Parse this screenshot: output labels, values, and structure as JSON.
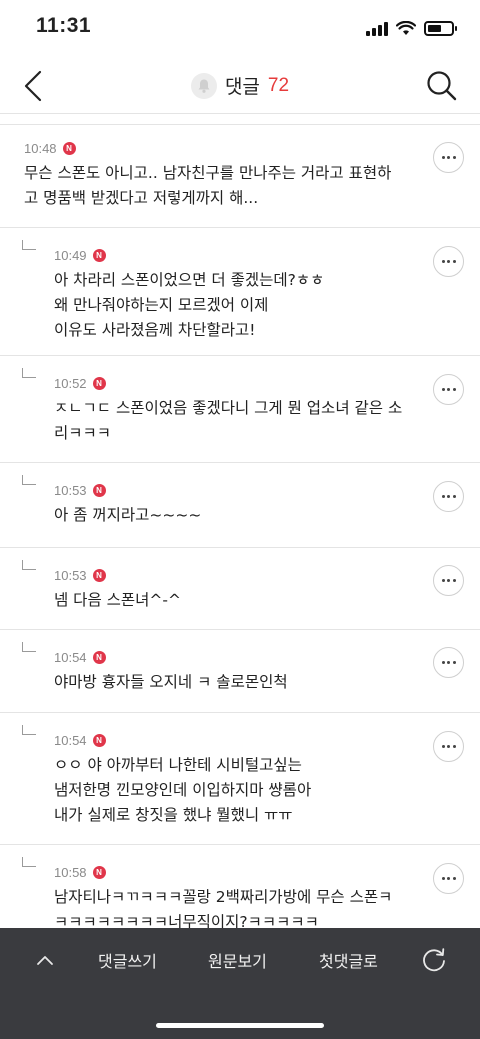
{
  "status_bar": {
    "time": "11:31"
  },
  "header": {
    "title": "댓글",
    "count": "72"
  },
  "comments": [
    {
      "time": "10:48",
      "badge": "N",
      "is_reply": false,
      "text": "무슨 스폰도 아니고.. 남자친구를 만나주는 거라고 표현하\n고 명품백 받겠다고 저렇게까지 해..."
    },
    {
      "time": "10:49",
      "badge": "N",
      "is_reply": true,
      "text": "아 차라리 스폰이었으면 더 좋겠는데?ㅎㅎ\n왜 만나줘야하는지 모르겠어 이제\n이유도 사라졌음께 차단할라고!"
    },
    {
      "time": "10:52",
      "badge": "N",
      "is_reply": true,
      "text": "ㅈㄴㄱㄷ 스폰이었음 좋겠다니 그게 뭔 업소녀 같은 소\n리ㅋㅋㅋ"
    },
    {
      "time": "10:53",
      "badge": "N",
      "is_reply": true,
      "text": "아 좀 꺼지라고~~~~"
    },
    {
      "time": "10:53",
      "badge": "N",
      "is_reply": true,
      "text": "넴 다음 스폰녀^-^"
    },
    {
      "time": "10:54",
      "badge": "N",
      "is_reply": true,
      "text": "야마방 흉자들 오지네 ㅋ 솔로몬인척"
    },
    {
      "time": "10:54",
      "badge": "N",
      "is_reply": true,
      "text": "ㅇㅇ 야 아까부터 나한테 시비털고싶는\n냄저한명 낀모양인데 이입하지마 썅롬아\n내가 실제로 창짓을 했냐 뭘했니 ㅠㅠ"
    },
    {
      "time": "10:58",
      "badge": "N",
      "is_reply": true,
      "text": "남자티나ㅋㄲㅋㅋㅋ꼴랑 2백짜리가방에 무슨 스폰ㅋ\nㅋㅋㅋㅋㅋㅋㅋㅋ너무직이지?ㅋㅋㅋㅋㅋ"
    }
  ],
  "bottom_bar": {
    "write_label": "댓글쓰기",
    "original_label": "원문보기",
    "first_label": "첫댓글로"
  }
}
